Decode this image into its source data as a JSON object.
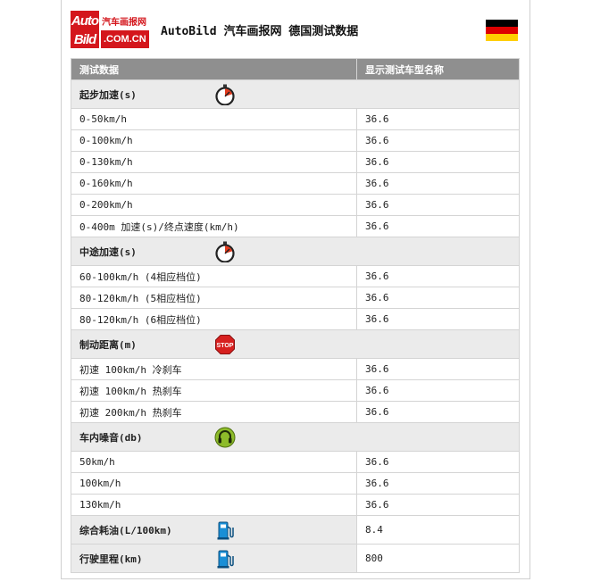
{
  "header": {
    "logo_top_text": "Auto",
    "logo_cn_text": "汽车画报网",
    "logo_bottom_text": "Bild",
    "logo_domain": ".COM.CN",
    "title": "AutoBild 汽车画报网 德国测试数据",
    "flag_colors": [
      "#000000",
      "#dd0000",
      "#ffce00"
    ]
  },
  "table": {
    "col1_header": "测试数据",
    "col2_header": "显示测试车型名称",
    "sections": [
      {
        "label": "起步加速(s)",
        "icon": "stopwatch-icon",
        "rows": [
          {
            "label": "0-50km/h",
            "value": "36.6"
          },
          {
            "label": "0-100km/h",
            "value": "36.6"
          },
          {
            "label": "0-130km/h",
            "value": "36.6"
          },
          {
            "label": "0-160km/h",
            "value": "36.6"
          },
          {
            "label": "0-200km/h",
            "value": "36.6"
          },
          {
            "label": "0-400m 加速(s)/终点速度(km/h)",
            "value": "36.6"
          }
        ]
      },
      {
        "label": "中途加速(s)",
        "icon": "stopwatch-icon",
        "rows": [
          {
            "label": "60-100km/h (4相应档位)",
            "value": "36.6"
          },
          {
            "label": "80-120km/h (5相应档位)",
            "value": "36.6"
          },
          {
            "label": "80-120km/h (6相应档位)",
            "value": "36.6"
          }
        ]
      },
      {
        "label": "制动距离(m)",
        "icon": "stop-sign-icon",
        "icon_text": "STOP",
        "rows": [
          {
            "label": "初速 100km/h 冷刹车",
            "value": "36.6"
          },
          {
            "label": "初速 100km/h 热刹车",
            "value": "36.6"
          },
          {
            "label": "初速 200km/h 热刹车",
            "value": "36.6"
          }
        ]
      },
      {
        "label": "车内噪音(db)",
        "icon": "headphones-icon",
        "rows": [
          {
            "label": "50km/h",
            "value": "36.6"
          },
          {
            "label": "100km/h",
            "value": "36.6"
          },
          {
            "label": "130km/h",
            "value": "36.6"
          }
        ]
      }
    ],
    "summary": [
      {
        "label": "综合耗油(L/100km)",
        "icon": "fuel-pump-icon",
        "value": "8.4"
      },
      {
        "label": "行驶里程(km)",
        "icon": "fuel-pump-icon",
        "value": "800"
      }
    ]
  }
}
